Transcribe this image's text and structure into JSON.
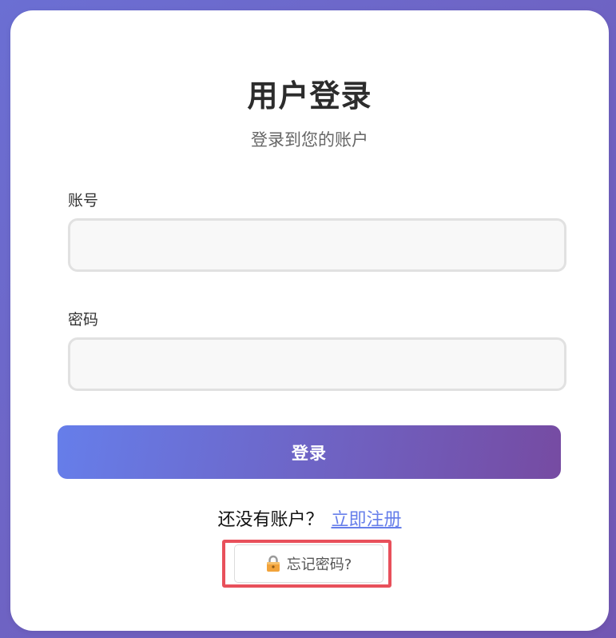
{
  "login": {
    "title": "用户登录",
    "subtitle": "登录到您的账户"
  },
  "form": {
    "account_label": "账号",
    "account_value": "",
    "password_label": "密码",
    "password_value": "",
    "submit_label": "登录"
  },
  "register": {
    "prompt": "还没有账户？",
    "link_label": "立即注册"
  },
  "forgot": {
    "icon": "lock-icon",
    "label": "忘记密码?"
  },
  "colors": {
    "background_start": "#6b6fd3",
    "background_end": "#7257b3",
    "button_gradient_start": "#667eea",
    "button_gradient_end": "#764ba2",
    "link": "#667eea",
    "highlight": "#e8505b"
  }
}
